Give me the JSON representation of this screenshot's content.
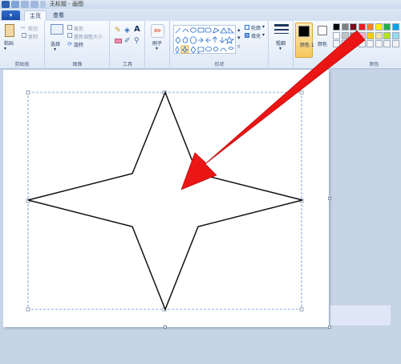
{
  "title": {
    "text": "无标题 - 画图"
  },
  "file_menu": {
    "label": "▾"
  },
  "tabs": [
    {
      "label": "主页",
      "active": true
    },
    {
      "label": "查看",
      "active": false
    }
  ],
  "ribbon": {
    "clipboard": {
      "paste": "粘贴",
      "cut": "剪切",
      "copy": "复制",
      "label": "剪贴板"
    },
    "image": {
      "select": "选择",
      "crop": "裁剪",
      "resize": "重新调整大小",
      "rotate": "旋转",
      "label": "图像"
    },
    "tools": {
      "label": "工具"
    },
    "brushes": {
      "label": "刷子"
    },
    "shapes": {
      "outline": "轮廓",
      "fill": "填充",
      "label": "形状"
    },
    "size": {
      "label": "粗细"
    },
    "color1": {
      "label": "颜色 1"
    },
    "color2": {
      "label": "颜色"
    },
    "colors": {
      "label": "颜色"
    }
  },
  "palette": {
    "row1": [
      "#000000",
      "#7f7f7f",
      "#880015",
      "#ed1c24",
      "#ff7f27",
      "#fff200",
      "#22b14c",
      "#00a2e8"
    ],
    "row2": [
      "#ffffff",
      "#c3c3c3",
      "#b97a57",
      "#ffaec9",
      "#ffc90e",
      "#efe4b0",
      "#b5e61d",
      "#99d9ea"
    ],
    "row3": [
      "#f4f4f4",
      "#f4f4f4",
      "#f4f4f4",
      "#f4f4f4",
      "#f4f4f4",
      "#f4f4f4",
      "#f4f4f4",
      "#f4f4f4"
    ],
    "color1": "#000000",
    "color2": "#ffffff"
  },
  "canvas": {
    "background": "#ffffff",
    "shape": "four-point-star",
    "stroke": "#000000",
    "selection": "dashed"
  },
  "annotation": {
    "arrow_color": "#ff0000"
  }
}
